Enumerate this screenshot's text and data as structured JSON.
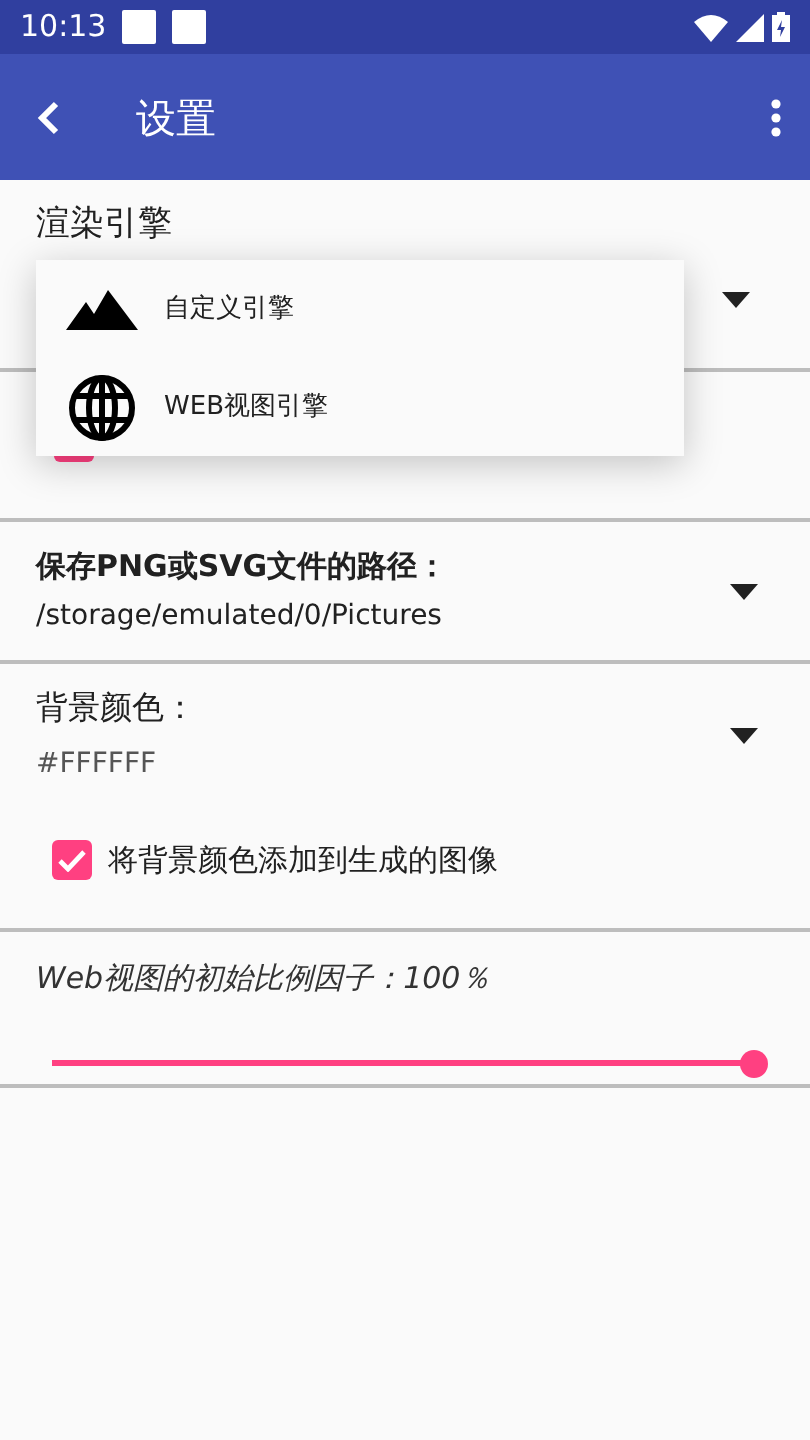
{
  "status_bar": {
    "time": "10:13"
  },
  "app_bar": {
    "title": "设置"
  },
  "engine": {
    "title": "渲染引擎",
    "covered_checkbox": {
      "checked": true
    }
  },
  "engine_menu": [
    {
      "kind": "mountain",
      "label": "自定义引擎"
    },
    {
      "kind": "globe",
      "label": "WEB视图引擎"
    }
  ],
  "save_path": {
    "title": "保存PNG或SVG文件的路径：",
    "value": "/storage/emulated/0/Pictures"
  },
  "background": {
    "title": "背景颜色：",
    "value": "#FFFFFF",
    "checkbox": {
      "label": "将背景颜色添加到生成的图像",
      "checked": true
    }
  },
  "scale": {
    "title": "Web视图的初始比例因子：100％",
    "level": 1.0
  }
}
